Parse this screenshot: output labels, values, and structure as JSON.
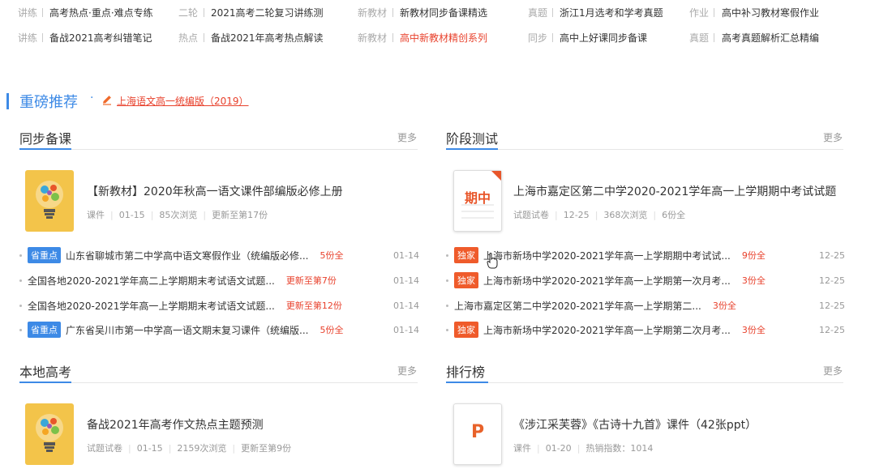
{
  "top_links": {
    "r1": [
      {
        "tag": "讲练",
        "label": "高考热点·重点·难点专练"
      },
      {
        "tag": "二轮",
        "label": "2021高考二轮复习讲练测"
      },
      {
        "tag": "新教材",
        "label": "新教材同步备课精选"
      },
      {
        "tag": "真题",
        "label": "浙江1月选考和学考真题"
      },
      {
        "tag": "作业",
        "label": "高中补习教材寒假作业"
      }
    ],
    "r2": [
      {
        "tag": "讲练",
        "label": "备战2021高考纠错笔记"
      },
      {
        "tag": "热点",
        "label": "备战2021年高考热点解读"
      },
      {
        "tag": "新教材",
        "label": "高中新教材精创系列"
      },
      {
        "tag": "同步",
        "label": "高中上好课同步备课"
      },
      {
        "tag": "真题",
        "label": "高考真题解析汇总精编"
      }
    ]
  },
  "recommend": {
    "title": "重磅推荐",
    "dot": "·",
    "link": "上海语文高一统编版（2019）"
  },
  "sync": {
    "title": "同步备课",
    "more": "更多",
    "featured": {
      "title": "【新教材】2020年秋高一语文课件部编版必修上册",
      "type": "课件",
      "date": "01-15",
      "views": "85次浏览",
      "update": "更新至第17份"
    },
    "items": [
      {
        "badge": "省重点",
        "text": "山东省聊城市第二中学高中语文寒假作业（统编版必修...",
        "extra": "5份全",
        "date": "01-14"
      },
      {
        "badge": "",
        "text": "全国各地2020-2021学年高二上学期期末考试语文试题...",
        "extra": "更新至第7份",
        "date": "01-14"
      },
      {
        "badge": "",
        "text": "全国各地2020-2021学年高一上学期期末考试语文试题...",
        "extra": "更新至第12份",
        "date": "01-14"
      },
      {
        "badge": "省重点",
        "text": "广东省吴川市第一中学高一语文期末复习课件（统编版...",
        "extra": "5份全",
        "date": "01-14"
      }
    ]
  },
  "stage": {
    "title": "阶段测试",
    "more": "更多",
    "featured": {
      "thumb_label": "期中",
      "title": "上海市嘉定区第二中学2020-2021学年高一上学期期中考试试题",
      "type": "试题试卷",
      "date": "12-25",
      "views": "368次浏览",
      "update": "6份全"
    },
    "items": [
      {
        "badge": "独家",
        "text": "上海市新场中学2020-2021学年高一上学期期中考试试...",
        "extra": "9份全",
        "date": "12-25"
      },
      {
        "badge": "独家",
        "text": "上海市新场中学2020-2021学年高一上学期第一次月考...",
        "extra": "3份全",
        "date": "12-25"
      },
      {
        "badge": "",
        "text": "上海市嘉定区第二中学2020-2021学年高一上学期第二...",
        "extra": "3份全",
        "date": "12-25"
      },
      {
        "badge": "独家",
        "text": "上海市新场中学2020-2021学年高一上学期第二次月考...",
        "extra": "3份全",
        "date": "12-25"
      }
    ]
  },
  "local": {
    "title": "本地高考",
    "more": "更多",
    "featured": {
      "title": "备战2021年高考作文热点主题预测",
      "type": "试题试卷",
      "date": "01-15",
      "views": "2159次浏览",
      "update": "更新至第9份"
    }
  },
  "ranking": {
    "title": "排行榜",
    "more": "更多",
    "featured": {
      "thumb_label": "P",
      "title": "《涉江采芙蓉》《古诗十九首》课件（42张ppt）",
      "type": "课件",
      "date": "01-20",
      "hot": "热销指数：1014"
    }
  },
  "colors": {
    "accent_blue": "#3d8ae6",
    "accent_red": "#e8412c",
    "badge_orange": "#ef5b2b",
    "ppt_orange": "#e8622a"
  }
}
